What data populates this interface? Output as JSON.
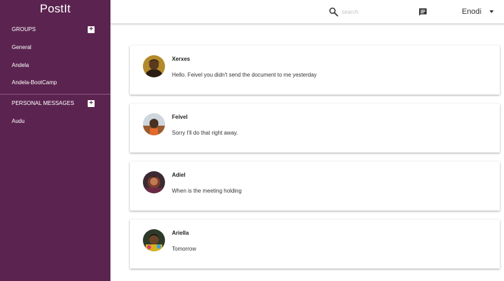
{
  "app": {
    "brand": "PostIt"
  },
  "sidebar": {
    "groups_heading": "GROUPS",
    "groups": [
      {
        "label": "General"
      },
      {
        "label": "Andela"
      },
      {
        "label": "Andela-BootCamp"
      }
    ],
    "personal_heading": "PERSONAL MESSAGES",
    "personal": [
      {
        "label": "Audu"
      }
    ]
  },
  "header": {
    "search_placeholder": "search",
    "user_name": "Enodi"
  },
  "messages": [
    {
      "author": "Xerxes",
      "text": "Hello. Feivel you didn't send the document to me yesterday"
    },
    {
      "author": "Feivel",
      "text": "Sorry I'll do that right away."
    },
    {
      "author": "Adiel",
      "text": "When is the meeting holding"
    },
    {
      "author": "Ariella",
      "text": "Tomorrow"
    }
  ],
  "colors": {
    "sidebar": "#5b2450",
    "accent_white": "#ffffff"
  }
}
